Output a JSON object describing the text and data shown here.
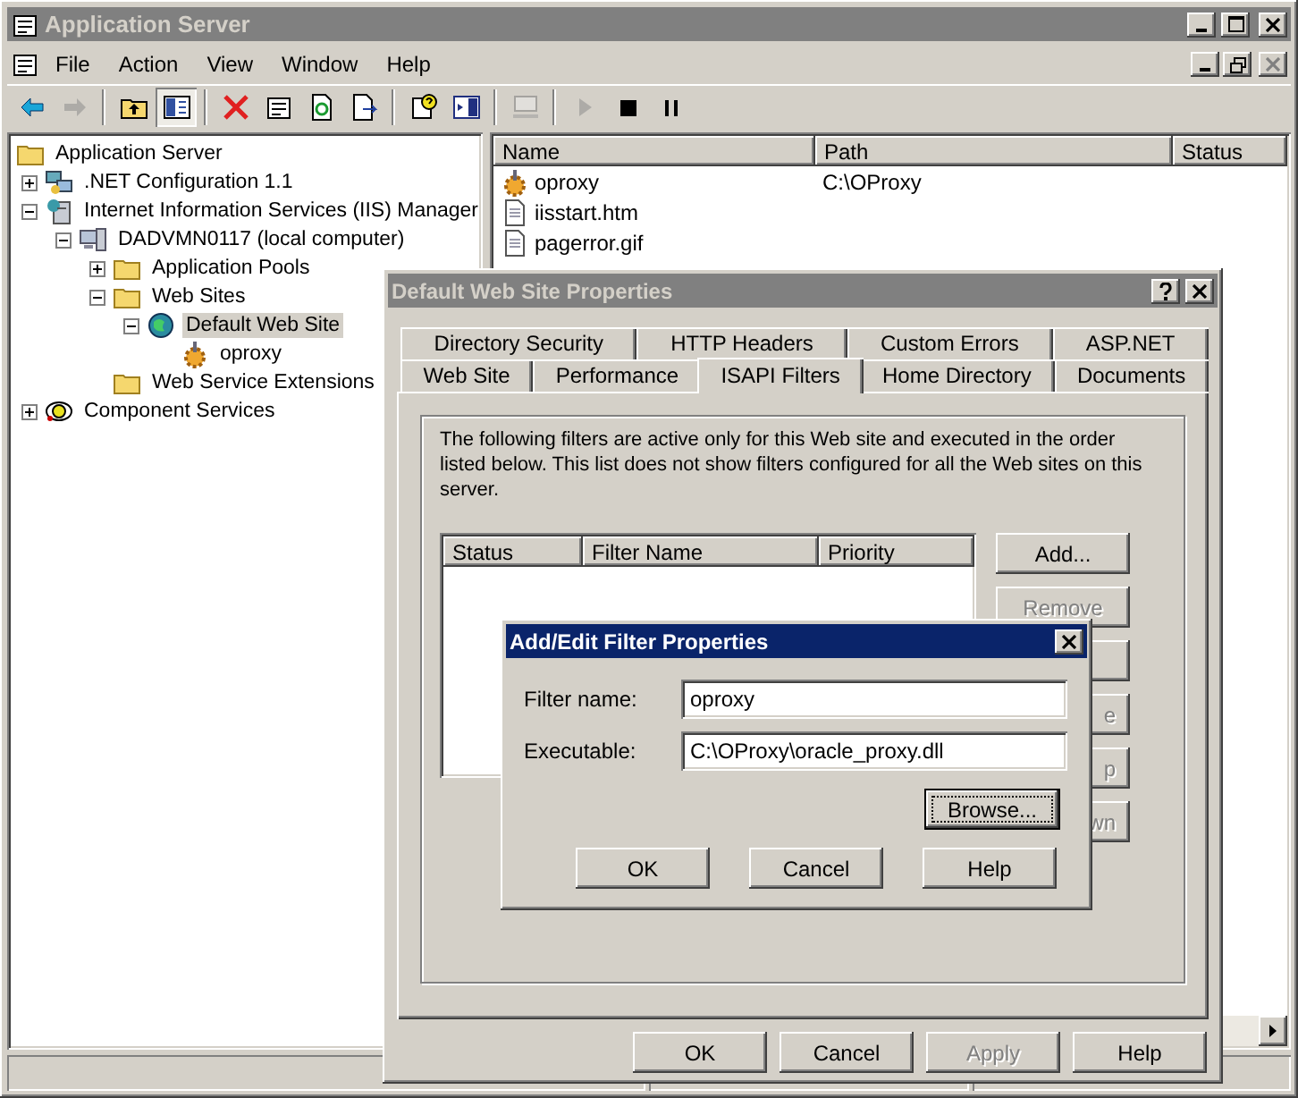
{
  "window": {
    "title": "Application Server"
  },
  "menu": [
    "File",
    "Action",
    "View",
    "Window",
    "Help"
  ],
  "toolbar": [
    {
      "kind": "back",
      "disabled": false,
      "pressed": false
    },
    {
      "kind": "forward",
      "disabled": true,
      "pressed": false
    },
    {
      "kind": "separator"
    },
    {
      "kind": "up",
      "disabled": false,
      "pressed": false
    },
    {
      "kind": "tree",
      "disabled": false,
      "pressed": true
    },
    {
      "kind": "separator"
    },
    {
      "kind": "delete",
      "disabled": false,
      "pressed": false
    },
    {
      "kind": "properties",
      "disabled": false,
      "pressed": false
    },
    {
      "kind": "refresh",
      "disabled": false,
      "pressed": false
    },
    {
      "kind": "export",
      "disabled": false,
      "pressed": false
    },
    {
      "kind": "separator"
    },
    {
      "kind": "help",
      "disabled": false,
      "pressed": false
    },
    {
      "kind": "pane",
      "disabled": false,
      "pressed": false
    },
    {
      "kind": "separator"
    },
    {
      "kind": "computer",
      "disabled": true,
      "pressed": false
    },
    {
      "kind": "separator"
    },
    {
      "kind": "play",
      "disabled": true,
      "pressed": false
    },
    {
      "kind": "stop",
      "disabled": false,
      "pressed": false
    },
    {
      "kind": "pause",
      "disabled": false,
      "pressed": false
    }
  ],
  "tree": [
    {
      "label": "Application Server",
      "kind": "folder",
      "selected": false,
      "children": [
        {
          "label": ".NET Configuration 1.1",
          "kind": "network",
          "expanded": false,
          "selected": false
        },
        {
          "label": "Internet Information Services (IIS) Manager",
          "kind": "server",
          "expanded": true,
          "selected": false,
          "children": [
            {
              "label": "DADVMN0117 (local computer)",
              "kind": "computer",
              "expanded": true,
              "selected": false,
              "children": [
                {
                  "label": "Application Pools",
                  "kind": "folder",
                  "expanded": false,
                  "selected": false
                },
                {
                  "label": "Web Sites",
                  "kind": "folder",
                  "expanded": true,
                  "selected": false,
                  "children": [
                    {
                      "label": "Default Web Site",
                      "kind": "globe",
                      "expanded": true,
                      "selected": true,
                      "children": [
                        {
                          "label": "oproxy",
                          "kind": "gear",
                          "selected": false
                        }
                      ]
                    }
                  ]
                },
                {
                  "label": "Web Service Extensions",
                  "kind": "folder",
                  "selected": false
                }
              ]
            }
          ]
        },
        {
          "label": "Component Services",
          "kind": "component",
          "expanded": false,
          "selected": false
        }
      ]
    }
  ],
  "list": {
    "columns": [
      "Name",
      "Path",
      "Status"
    ],
    "rows": [
      {
        "name": "oproxy",
        "path": "C:\\OProxy",
        "kind": "gear"
      },
      {
        "name": "iisstart.htm",
        "kind": "document"
      },
      {
        "name": "pagerror.gif",
        "kind": "document"
      }
    ]
  },
  "properties_dialog": {
    "title": "Default Web Site Properties",
    "tab_rows": [
      [
        {
          "label": "Directory Security",
          "selected": false
        },
        {
          "label": "HTTP Headers",
          "selected": false
        },
        {
          "label": "Custom Errors",
          "selected": false
        },
        {
          "label": "ASP.NET",
          "selected": false
        }
      ],
      [
        {
          "label": "Web Site",
          "selected": false
        },
        {
          "label": "Performance",
          "selected": false
        },
        {
          "label": "ISAPI Filters",
          "selected": true
        },
        {
          "label": "Home Directory",
          "selected": false
        },
        {
          "label": "Documents",
          "selected": false
        }
      ]
    ],
    "description": "The following filters are active only for this Web site and executed in the order listed below. This list does not show filters configured for all the Web sites on this server.",
    "filter_columns": [
      "Status",
      "Filter Name",
      "Priority"
    ],
    "side_buttons": [
      {
        "label": "Add...",
        "disabled": false,
        "kind": "full"
      },
      {
        "label": "Remove",
        "disabled": true,
        "kind": "full"
      },
      {
        "kind": "full"
      },
      {
        "label": "e",
        "disabled": true,
        "kind": "partial"
      },
      {
        "label": "p",
        "disabled": true,
        "kind": "partial"
      },
      {
        "label": "wn",
        "disabled": true,
        "kind": "partial"
      }
    ],
    "buttons": [
      {
        "label": "OK",
        "disabled": false
      },
      {
        "label": "Cancel",
        "disabled": false
      },
      {
        "label": "Apply",
        "disabled": true
      },
      {
        "label": "Help",
        "disabled": false
      }
    ]
  },
  "filter_dialog": {
    "title": "Add/Edit Filter Properties",
    "fields": [
      {
        "label": "Filter name:",
        "value": "oproxy"
      },
      {
        "label": "Executable:",
        "value": "C:\\OProxy\\oracle_proxy.dll"
      }
    ],
    "browse": {
      "label": "Browse...",
      "focused": true
    },
    "buttons": [
      "OK",
      "Cancel",
      "Help"
    ]
  }
}
